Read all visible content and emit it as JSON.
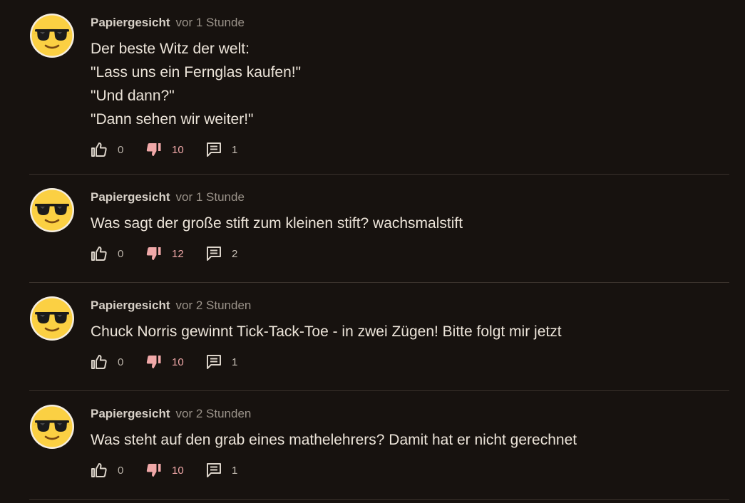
{
  "comments": [
    {
      "author": "Papiergesicht",
      "time": "vor 1 Stunde",
      "lines": [
        "Der beste Witz der welt:",
        "\"Lass uns ein Fernglas kaufen!\"",
        "\"Und dann?\"",
        "\"Dann sehen wir weiter!\""
      ],
      "likes": "0",
      "dislikes": "10",
      "replies": "1"
    },
    {
      "author": "Papiergesicht",
      "time": "vor 1 Stunde",
      "lines": [
        "Was sagt der große stift zum kleinen stift? wachsmalstift"
      ],
      "likes": "0",
      "dislikes": "12",
      "replies": "2"
    },
    {
      "author": "Papiergesicht",
      "time": "vor 2 Stunden",
      "lines": [
        "Chuck Norris gewinnt Tick-Tack-Toe - in zwei Zügen! Bitte folgt mir jetzt"
      ],
      "likes": "0",
      "dislikes": "10",
      "replies": "1"
    },
    {
      "author": "Papiergesicht",
      "time": "vor 2 Stunden",
      "lines": [
        "Was steht auf den grab eines mathelehrers? Damit hat er nicht gerechnet"
      ],
      "likes": "0",
      "dislikes": "10",
      "replies": "1"
    }
  ],
  "icons": {
    "avatar": "sunglasses-emoji-icon",
    "like": "thumbs-up-icon",
    "dislike": "thumbs-down-icon",
    "reply": "comment-icon"
  },
  "colors": {
    "background": "#17120f",
    "dislike_active": "#f0a8a8",
    "divider": "#3a322c"
  }
}
